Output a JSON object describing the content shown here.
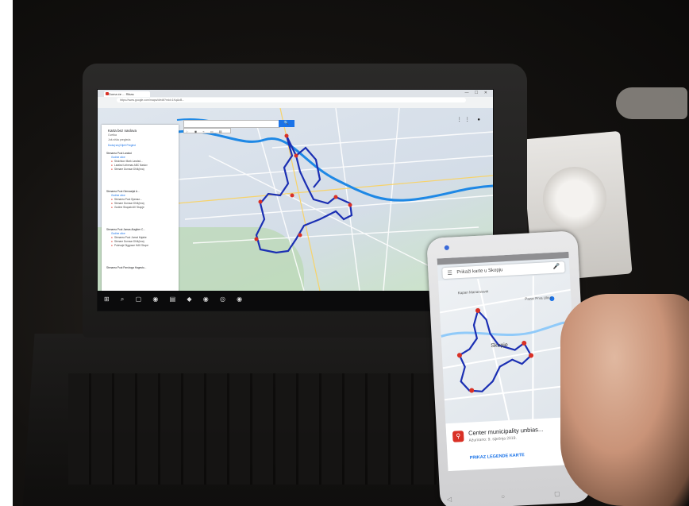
{
  "browser": {
    "tab_title": "Doma će ... Rikas",
    "url": "https://www.google.com/maps/d/edit?mid=1KqAcB...",
    "window_controls": "— ☐ ✕"
  },
  "map_panel": {
    "title": "Karta bez naslova",
    "subtitle": "Cvetka",
    "views": "Još ništa pregleda",
    "actions": "Dodaj sloj   Dijeli   Pregled",
    "layers": [
      {
        "name": "Stenarea Pout Laralsd",
        "sub": "Godine ulice",
        "points": [
          "Stoichkov Mark Laralsd...",
          "Laralsd Uchenas ABC Naslov",
          "Stenare Dumsar DN4(ima)"
        ]
      },
      {
        "name": "Stenarea Pout Gimnazijal A...",
        "sub": "Godine ulice",
        "points": [
          "Stenarea Pout Djanaur...",
          "Stenare Dumsar DN4(ima)",
          "Godine Skopaki AV Skopje"
        ]
      },
      {
        "name": "Stenarea Pout Jamas Alagiber C...",
        "sub": "Godine ulice",
        "points": [
          "Stenarea Pout Jumat Kajabe",
          "Stenare Dumsar DN4(ima)",
          "Putevaje Diggrace HA5 Skope"
        ]
      },
      {
        "name": "Stenarea Pout Parshoga Hagesto...",
        "sub": "",
        "points": []
      }
    ],
    "search_button": "🔍",
    "tools": "☞ ◉ ⌁ ▭ ▤",
    "account_icons": "⋮⋮ ●"
  },
  "taskbar": {
    "icons": "⊞ ⌕ ▢ ◉ ▤ ◆ ◉ ◎ ◉"
  },
  "phone": {
    "search_text": "Prikaži karte u Skopju",
    "menu_icon": "☰",
    "mic_icon": "🎤",
    "card_title": "Center municipality unbias...",
    "card_date": "Ažurirano: 9. siječnja 2019.",
    "card_link": "PRIKAZ LEGENDE KARTE",
    "card_icon": "⚲",
    "map_label_city": "Skopje",
    "map_label_1": "Pazar Prva Ulica",
    "map_label_2": "Kapan Mananzaviri",
    "nav_buttons": "◁ ○ ▢"
  },
  "colors": {
    "route": "#1b2fb3",
    "marker": "#d93025",
    "google_blue": "#1a73e8",
    "water": "#1e88e5"
  }
}
